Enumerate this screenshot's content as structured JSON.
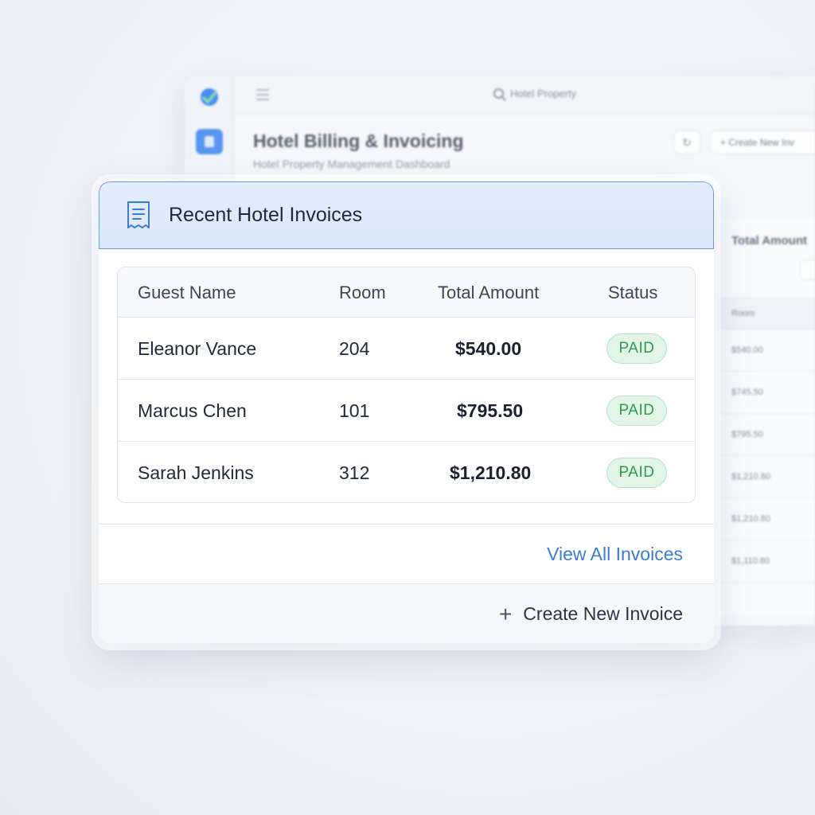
{
  "background": {
    "search_text": "Hotel Property",
    "title": "Hotel Billing & Invoicing",
    "subtitle": "Hotel Property Management Dashboard",
    "create_button": "+ Create New Inv",
    "refresh_icon": "refresh-icon",
    "table_header": "Total Amount",
    "subheader": "Room",
    "rows": [
      "$540.00",
      "$745.50",
      "$795.50",
      "$1,210.80",
      "$1,210.80",
      "$1,110.80"
    ]
  },
  "card": {
    "title": "Recent Hotel Invoices",
    "header_icon": "receipt-icon",
    "columns": [
      "Guest Name",
      "Room",
      "Total Amount",
      "Status"
    ],
    "rows": [
      {
        "guest": "Eleanor Vance",
        "room": "204",
        "amount": "$540.00",
        "status": "PAID"
      },
      {
        "guest": "Marcus Chen",
        "room": "101",
        "amount": "$795.50",
        "status": "PAID"
      },
      {
        "guest": "Sarah Jenkins",
        "room": "312",
        "amount": "$1,210.80",
        "status": "PAID"
      }
    ],
    "view_all_label": "View All Invoices",
    "create_label": "Create New Invoice",
    "create_icon": "plus-icon"
  },
  "colors": {
    "accent": "#3b7bd0",
    "header_bg": "#dde9fb",
    "paid_text": "#2d9a4c",
    "paid_bg": "#e3f5e7"
  }
}
